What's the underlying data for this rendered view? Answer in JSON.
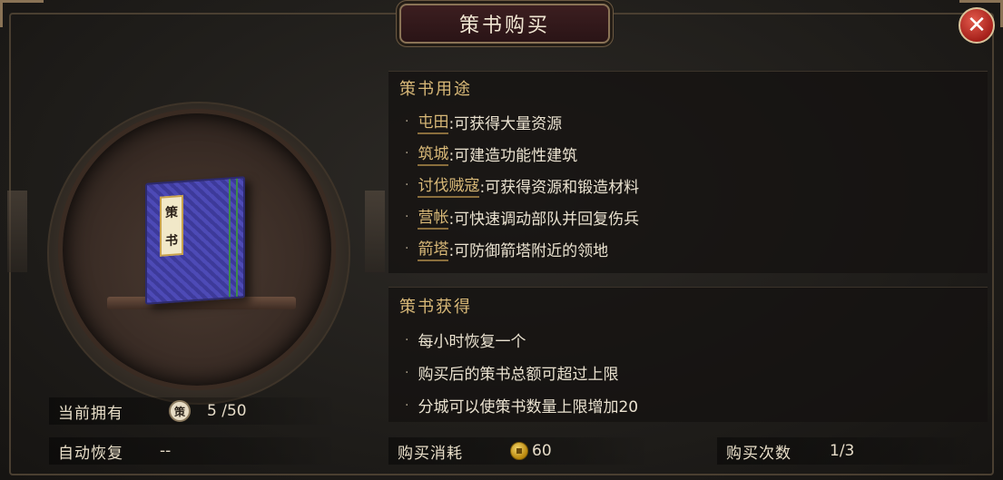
{
  "header": {
    "title": "策书购买",
    "close_glyph": "✕"
  },
  "item": {
    "label_char_1": "策",
    "label_char_2": "书",
    "icon": "book-icon"
  },
  "usage": {
    "title": "策书用途",
    "items": [
      {
        "keyword": "屯田",
        "text": ":可获得大量资源"
      },
      {
        "keyword": "筑城",
        "text": ":可建造功能性建筑"
      },
      {
        "keyword": "讨伐贼寇",
        "text": ":可获得资源和锻造材料"
      },
      {
        "keyword": "营帐",
        "text": ":可快速调动部队并回复伤兵"
      },
      {
        "keyword": "箭塔",
        "text": ":可防御箭塔附近的领地"
      }
    ]
  },
  "obtain": {
    "title": "策书获得",
    "items": [
      "每小时恢复一个",
      "购买后的策书总额可超过上限",
      "分城可以使策书数量上限增加20"
    ]
  },
  "stats": {
    "owned_label": "当前拥有",
    "owned_icon_char": "策",
    "owned_value": "5 /50",
    "recover_label": "自动恢复",
    "recover_value": "--"
  },
  "purchase": {
    "cost_label": "购买消耗",
    "cost_value": "60",
    "times_label": "购买次数",
    "times_value": "1/3"
  },
  "colors": {
    "accent_gold": "#d9b978",
    "close_red": "#c0392b",
    "book_blue": "#4d4ab6"
  }
}
